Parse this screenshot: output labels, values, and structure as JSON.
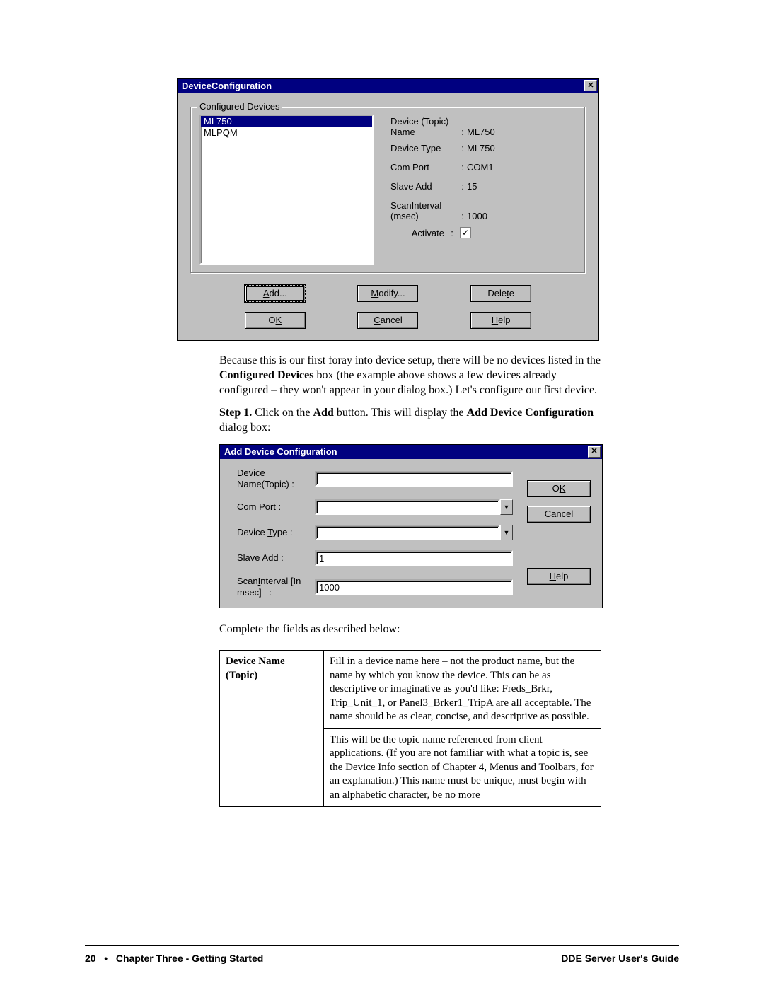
{
  "dialog1": {
    "title": "DeviceConfiguration",
    "group_label": "Configured  Devices",
    "list": {
      "item0": "ML750",
      "item1": "MLPQM"
    },
    "labels": {
      "device_topic_l1": "Device (Topic)",
      "device_topic_l2": "Name",
      "device_type": "Device Type",
      "com_port": "Com Port",
      "slave_add": "Slave Add",
      "scan_l1": "ScanInterval",
      "scan_l2": "(msec)",
      "activate": "Activate"
    },
    "values": {
      "name": "ML750",
      "type": "ML750",
      "com": "COM1",
      "slave": "15",
      "scan": "1000"
    },
    "buttons": {
      "add": "Add...",
      "modify": "Modify...",
      "delete": "Delete",
      "ok": "OK",
      "cancel": "Cancel",
      "help": "Help"
    }
  },
  "body_text": {
    "p1a": "Because this is our first foray into device setup, there will be no devices listed in the ",
    "p1b": "Configured Devices",
    "p1c": " box (the example above shows a few devices already configured – they won't appear in your dialog box.) Let's configure our first device.",
    "p2a": "Step 1.",
    "p2b": " Click on the ",
    "p2c": "Add",
    "p2d": " button. This will display the ",
    "p2e": "Add Device Configuration",
    "p2f": " dialog box:",
    "p3": "Complete the fields as described below:"
  },
  "dialog2": {
    "title": "Add Device Configuration",
    "labels": {
      "device_l1": "Device",
      "device_l2": "Name(Topic) :",
      "comport": "Com Port :",
      "dtype": "Device Type :",
      "slave": "Slave Add :",
      "scan_l1": "ScanInterval [In",
      "scan_l2": "msec]   :"
    },
    "values": {
      "slave": "1",
      "scan": "1000"
    },
    "buttons": {
      "ok": "OK",
      "cancel": "Cancel",
      "help": "Help"
    }
  },
  "table": {
    "h1": "Device Name (Topic)",
    "c1": "Fill in a device name here – not the product name, but the name by which you know the device. This can be as descriptive or imaginative as you'd like: Freds_Brkr, Trip_Unit_1, or Panel3_Brker1_TripA are all acceptable. The name should be as clear, concise, and descriptive as possible.",
    "c2": "This will be the topic name referenced from client applications. (If you are not familiar with what a topic is, see the Device Info section of Chapter 4, Menus and Toolbars, for an explanation.) This name must be unique, must begin with an alphabetic character, be no more"
  },
  "footer": {
    "page": "20",
    "chapter": "Chapter Three - Getting Started",
    "guide": "DDE Server User's Guide"
  }
}
